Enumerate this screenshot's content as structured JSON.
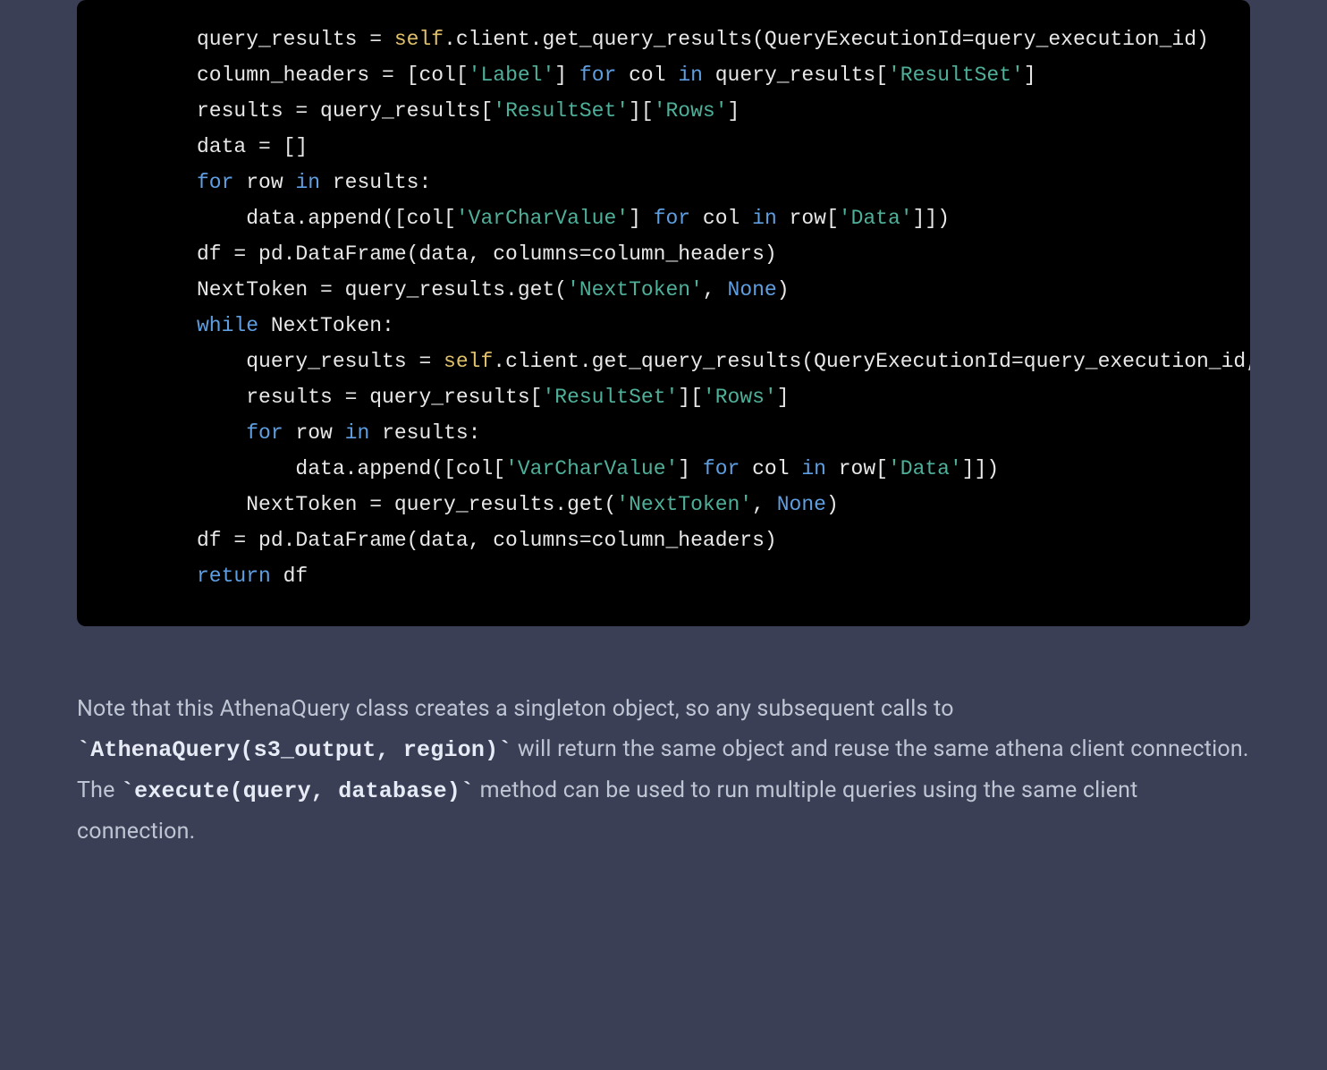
{
  "code": {
    "lines": [
      [
        {
          "t": "def",
          "v": "query_results = "
        },
        {
          "t": "self",
          "v": "self"
        },
        {
          "t": "def",
          "v": ".client.get_query_results(QueryExecutionId=query_execution_id)"
        }
      ],
      [
        {
          "t": "def",
          "v": "column_headers = [col["
        },
        {
          "t": "str",
          "v": "'Label'"
        },
        {
          "t": "def",
          "v": "] "
        },
        {
          "t": "kw",
          "v": "for"
        },
        {
          "t": "def",
          "v": " col "
        },
        {
          "t": "kw",
          "v": "in"
        },
        {
          "t": "def",
          "v": " query_results["
        },
        {
          "t": "str",
          "v": "'ResultSet'"
        },
        {
          "t": "def",
          "v": "]"
        }
      ],
      [
        {
          "t": "def",
          "v": "results = query_results["
        },
        {
          "t": "str",
          "v": "'ResultSet'"
        },
        {
          "t": "def",
          "v": "]["
        },
        {
          "t": "str",
          "v": "'Rows'"
        },
        {
          "t": "def",
          "v": "]"
        }
      ],
      [
        {
          "t": "def",
          "v": "data = []"
        }
      ],
      [
        {
          "t": "kw",
          "v": "for"
        },
        {
          "t": "def",
          "v": " row "
        },
        {
          "t": "kw",
          "v": "in"
        },
        {
          "t": "def",
          "v": " results:"
        }
      ],
      [
        {
          "t": "def",
          "v": "    data.append([col["
        },
        {
          "t": "str",
          "v": "'VarCharValue'"
        },
        {
          "t": "def",
          "v": "] "
        },
        {
          "t": "kw",
          "v": "for"
        },
        {
          "t": "def",
          "v": " col "
        },
        {
          "t": "kw",
          "v": "in"
        },
        {
          "t": "def",
          "v": " row["
        },
        {
          "t": "str",
          "v": "'Data'"
        },
        {
          "t": "def",
          "v": "]])"
        }
      ],
      [
        {
          "t": "def",
          "v": "df = pd.DataFrame(data, columns=column_headers)"
        }
      ],
      [
        {
          "t": "def",
          "v": "NextToken = query_results.get("
        },
        {
          "t": "str",
          "v": "'NextToken'"
        },
        {
          "t": "def",
          "v": ", "
        },
        {
          "t": "none",
          "v": "None"
        },
        {
          "t": "def",
          "v": ")"
        }
      ],
      [
        {
          "t": "kw",
          "v": "while"
        },
        {
          "t": "def",
          "v": " NextToken:"
        }
      ],
      [
        {
          "t": "def",
          "v": "    query_results = "
        },
        {
          "t": "self",
          "v": "self"
        },
        {
          "t": "def",
          "v": ".client.get_query_results(QueryExecutionId=query_execution_id, NextToken=NextToken)"
        }
      ],
      [
        {
          "t": "def",
          "v": "    results = query_results["
        },
        {
          "t": "str",
          "v": "'ResultSet'"
        },
        {
          "t": "def",
          "v": "]["
        },
        {
          "t": "str",
          "v": "'Rows'"
        },
        {
          "t": "def",
          "v": "]"
        }
      ],
      [
        {
          "t": "def",
          "v": "    "
        },
        {
          "t": "kw",
          "v": "for"
        },
        {
          "t": "def",
          "v": " row "
        },
        {
          "t": "kw",
          "v": "in"
        },
        {
          "t": "def",
          "v": " results:"
        }
      ],
      [
        {
          "t": "def",
          "v": "        data.append([col["
        },
        {
          "t": "str",
          "v": "'VarCharValue'"
        },
        {
          "t": "def",
          "v": "] "
        },
        {
          "t": "kw",
          "v": "for"
        },
        {
          "t": "def",
          "v": " col "
        },
        {
          "t": "kw",
          "v": "in"
        },
        {
          "t": "def",
          "v": " row["
        },
        {
          "t": "str",
          "v": "'Data'"
        },
        {
          "t": "def",
          "v": "]])"
        }
      ],
      [
        {
          "t": "def",
          "v": "    NextToken = query_results.get("
        },
        {
          "t": "str",
          "v": "'NextToken'"
        },
        {
          "t": "def",
          "v": ", "
        },
        {
          "t": "none",
          "v": "None"
        },
        {
          "t": "def",
          "v": ")"
        }
      ],
      [
        {
          "t": "def",
          "v": "df = pd.DataFrame(data, columns=column_headers)"
        }
      ],
      [
        {
          "t": "kw",
          "v": "return"
        },
        {
          "t": "def",
          "v": " df"
        }
      ]
    ]
  },
  "prose": {
    "segments": [
      {
        "kind": "text",
        "value": "Note that this AthenaQuery class creates a singleton object, so any subsequent calls to "
      },
      {
        "kind": "code",
        "value": "`AthenaQuery(s3_output, region)`"
      },
      {
        "kind": "text",
        "value": " will return the same object and reuse the same athena client connection. The "
      },
      {
        "kind": "code",
        "value": "`execute(query, database)`"
      },
      {
        "kind": "text",
        "value": " method can be used to run multiple queries using the same client connection."
      }
    ]
  }
}
